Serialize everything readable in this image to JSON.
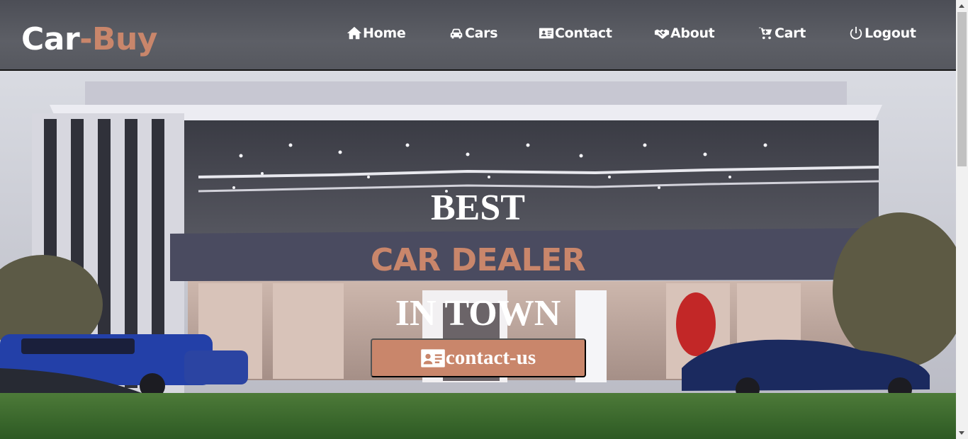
{
  "logo": {
    "part1": "Car",
    "part2": "-Buy"
  },
  "nav": {
    "home": "Home",
    "cars": "Cars",
    "contact": "Contact",
    "about": "About",
    "cart": "Cart",
    "logout": "Logout"
  },
  "hero": {
    "line1": "BEST",
    "line2": "CAR DEALER",
    "line3": "IN TOWN",
    "button_label": "contact-us"
  },
  "icons": {
    "home": "home-icon",
    "cars": "car-icon",
    "contact": "id-card-icon",
    "about": "handshake-icon",
    "cart": "cart-icon",
    "logout": "power-icon",
    "button": "id-card-icon"
  },
  "colors": {
    "accent": "#c9866b",
    "header_bg": "#55575e",
    "text": "#ffffff"
  }
}
